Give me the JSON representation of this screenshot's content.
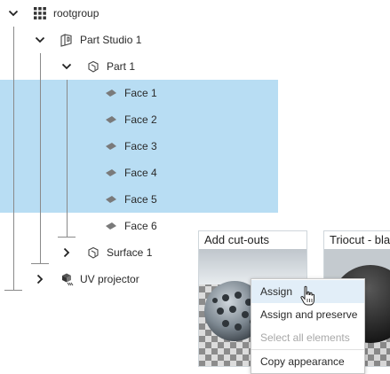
{
  "tree": {
    "rows": [
      {
        "label": "rootgroup",
        "icon": "grid-icon",
        "chevron": "down"
      },
      {
        "label": "Part Studio 1",
        "icon": "part-studio-icon",
        "chevron": "down"
      },
      {
        "label": "Part 1",
        "icon": "part-icon",
        "chevron": "down"
      },
      {
        "label": "Face 1",
        "icon": "face-icon",
        "selected": true
      },
      {
        "label": "Face 2",
        "icon": "face-icon",
        "selected": true
      },
      {
        "label": "Face 3",
        "icon": "face-icon",
        "selected": true
      },
      {
        "label": "Face 4",
        "icon": "face-icon",
        "selected": true
      },
      {
        "label": "Face 5",
        "icon": "face-icon",
        "selected": true
      },
      {
        "label": "Face 6",
        "icon": "face-icon",
        "selected": false
      },
      {
        "label": "Surface 1",
        "icon": "surface-icon",
        "chevron": "right"
      },
      {
        "label": "UV projector",
        "icon": "uv-projector-icon",
        "chevron": "right"
      }
    ]
  },
  "cards": [
    {
      "title": "Add cut-outs"
    },
    {
      "title": "Triocut - bla"
    }
  ],
  "context_menu": {
    "items": [
      {
        "label": "Assign",
        "state": "hover"
      },
      {
        "label": "Assign and preserve",
        "state": "normal"
      },
      {
        "label": "Select all elements",
        "state": "disabled"
      },
      {
        "label": "Copy appearance",
        "state": "normal"
      }
    ]
  },
  "colors": {
    "selection": "#b8ddf3",
    "menu_hover": "#e2eef8",
    "tree_line": "#8a8a8a"
  }
}
